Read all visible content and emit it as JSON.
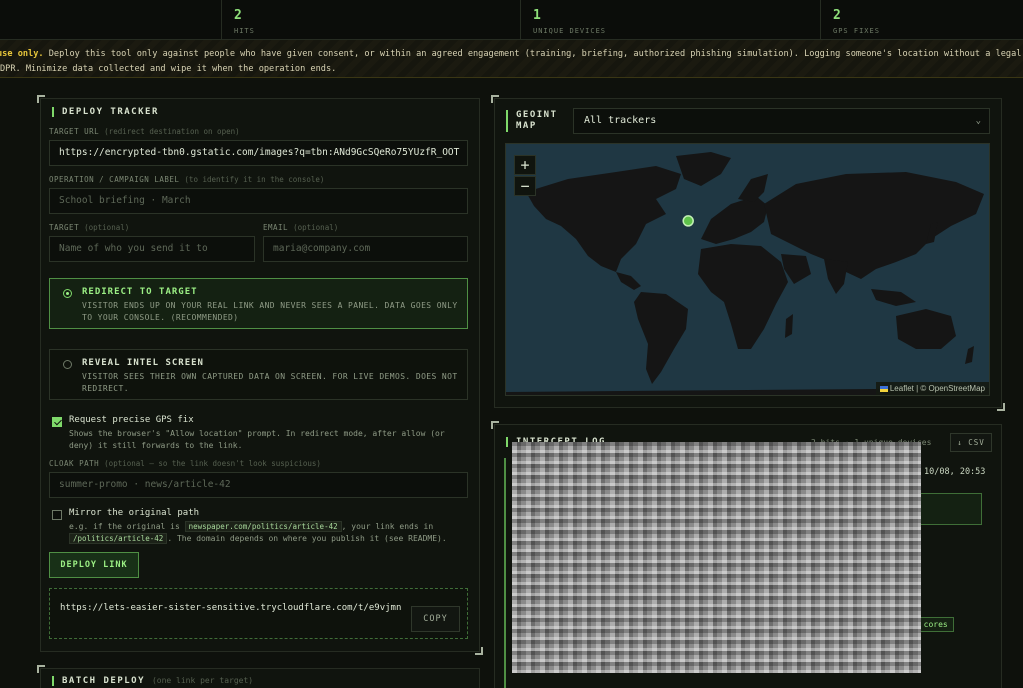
{
  "stats": [
    {
      "value": "2",
      "label": "HITS"
    },
    {
      "value": "1",
      "label": "UNIQUE DEVICES"
    },
    {
      "value": "2",
      "label": "GPS FIXES"
    }
  ],
  "banner": {
    "warn": "use only.",
    "line1": " Deploy this tool only against people who have given consent, or within an agreed engagement (training, briefing, authorized phishing simulation). Logging someone's location without a legal b",
    "line2": "DPR. Minimize data collected and wipe it when the operation ends."
  },
  "deploy": {
    "title": "DEPLOY TRACKER",
    "target_url": {
      "label": "TARGET URL",
      "hint": "(redirect destination on open)",
      "value": "https://encrypted-tbn0.gstatic.com/images?q=tbn:ANd9GcSQeRo75YUzfR_OOT"
    },
    "operation": {
      "label": "OPERATION / CAMPAIGN LABEL",
      "hint": "(to identify it in the console)",
      "placeholder": "School briefing · March"
    },
    "target": {
      "label": "TARGET",
      "hint": "(optional)",
      "placeholder": "Name of who you send it to"
    },
    "email": {
      "label": "EMAIL",
      "hint": "(optional)",
      "placeholder": "maria@company.com"
    },
    "modes": [
      {
        "title": "REDIRECT TO TARGET",
        "desc": "VISITOR ENDS UP ON YOUR REAL LINK AND NEVER SEES A PANEL. DATA GOES ONLY TO YOUR CONSOLE. (RECOMMENDED)",
        "selected": true
      },
      {
        "title": "REVEAL INTEL SCREEN",
        "desc": "VISITOR SEES THEIR OWN CAPTURED DATA ON SCREEN. FOR LIVE DEMOS. DOES NOT REDIRECT.",
        "selected": false
      }
    ],
    "gps": {
      "title": "Request precise GPS fix",
      "desc": "Shows the browser's \"Allow location\" prompt. In redirect mode, after allow (or deny) it still forwards to the link.",
      "checked": true
    },
    "cloak": {
      "label": "CLOAK PATH",
      "hint": "(optional — so the link doesn't look suspicious)",
      "placeholder": "summer-promo   ·   news/article-42"
    },
    "mirror": {
      "title": "Mirror the original path",
      "desc_pre": "e.g. if the original is",
      "code1": "newspaper.com/politics/article-42",
      "desc_mid": ", your link ends in",
      "code2": "/politics/article-42",
      "desc_post": ". The domain depends on where you publish it (see README).",
      "checked": false
    },
    "deploy_button": "DEPLOY LINK",
    "generated_link": "https://lets-easier-sister-sensitive.trycloudflare.com/t/e9vjmn",
    "copy_button": "COPY"
  },
  "batch": {
    "title": "BATCH DEPLOY",
    "hint": "(one link per target)"
  },
  "geoint": {
    "title": "GEOINT MAP",
    "select_value": "All trackers",
    "zoom_in": "+",
    "zoom_out": "−",
    "attribution_leaflet": "Leaflet",
    "attribution_sep": " | © OpenStreetMap",
    "marker": {
      "lon": -9.1,
      "lat": 38.7
    }
  },
  "log": {
    "title": "INTERCEPT LOG",
    "meta": "2 hits · 1 unique devices",
    "csv_button": "↓ CSV",
    "timestamp": "10/08, 20:53",
    "cores_chip": "0 cores"
  },
  "colors": {
    "accent": "#7fd96a",
    "bg": "#0e110c",
    "warning": "#e7c63b"
  }
}
